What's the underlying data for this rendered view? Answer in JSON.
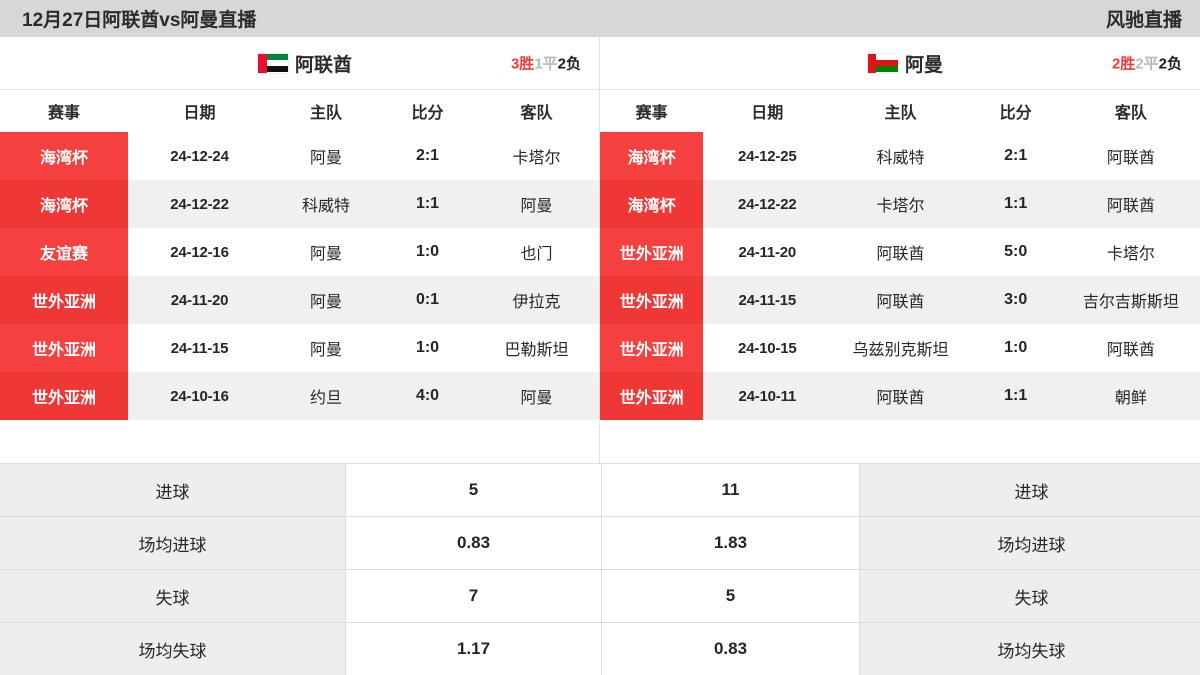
{
  "titlebar": {
    "match_title": "12月27日阿联酋vs阿曼直播",
    "site_brand": "风驰直播"
  },
  "colors": {
    "accent_red": "#f4403f",
    "win_red": "#ef3b3b",
    "draw_gray": "#b9b9b9",
    "loss_black": "#1c1c1c",
    "titlebar_bg": "#d7d7d7",
    "row_alt_bg": "#f0f0f0",
    "stats_label_bg": "#eeeeee"
  },
  "left_panel": {
    "team": {
      "name": "阿联酋",
      "flag_icon": "flag-uae-icon",
      "record": {
        "win": "3胜",
        "draw": "1平",
        "loss": "2负"
      }
    },
    "columns": [
      "赛事",
      "日期",
      "主队",
      "比分",
      "客队"
    ],
    "rows": [
      {
        "league": "海湾杯",
        "date": "24-12-24",
        "home": "阿曼",
        "score": "2:1",
        "away": "卡塔尔"
      },
      {
        "league": "海湾杯",
        "date": "24-12-22",
        "home": "科威特",
        "score": "1:1",
        "away": "阿曼"
      },
      {
        "league": "友谊赛",
        "date": "24-12-16",
        "home": "阿曼",
        "score": "1:0",
        "away": "也门"
      },
      {
        "league": "世外亚洲",
        "date": "24-11-20",
        "home": "阿曼",
        "score": "0:1",
        "away": "伊拉克"
      },
      {
        "league": "世外亚洲",
        "date": "24-11-15",
        "home": "阿曼",
        "score": "1:0",
        "away": "巴勒斯坦"
      },
      {
        "league": "世外亚洲",
        "date": "24-10-16",
        "home": "约旦",
        "score": "4:0",
        "away": "阿曼"
      }
    ]
  },
  "right_panel": {
    "team": {
      "name": "阿曼",
      "flag_icon": "flag-oman-icon",
      "record": {
        "win": "2胜",
        "draw": "2平",
        "loss": "2负"
      }
    },
    "columns": [
      "赛事",
      "日期",
      "主队",
      "比分",
      "客队"
    ],
    "rows": [
      {
        "league": "海湾杯",
        "date": "24-12-25",
        "home": "科威特",
        "score": "2:1",
        "away": "阿联酋"
      },
      {
        "league": "海湾杯",
        "date": "24-12-22",
        "home": "卡塔尔",
        "score": "1:1",
        "away": "阿联酋"
      },
      {
        "league": "世外亚洲",
        "date": "24-11-20",
        "home": "阿联酋",
        "score": "5:0",
        "away": "卡塔尔"
      },
      {
        "league": "世外亚洲",
        "date": "24-11-15",
        "home": "阿联酋",
        "score": "3:0",
        "away": "吉尔吉斯斯坦"
      },
      {
        "league": "世外亚洲",
        "date": "24-10-15",
        "home": "乌兹别克斯坦",
        "score": "1:0",
        "away": "阿联酋"
      },
      {
        "league": "世外亚洲",
        "date": "24-10-11",
        "home": "阿联酋",
        "score": "1:1",
        "away": "朝鲜"
      }
    ]
  },
  "stats": {
    "rows": [
      {
        "left_label": "进球",
        "left_value": "5",
        "right_value": "11",
        "right_label": "进球"
      },
      {
        "left_label": "场均进球",
        "left_value": "0.83",
        "right_value": "1.83",
        "right_label": "场均进球"
      },
      {
        "left_label": "失球",
        "left_value": "7",
        "right_value": "5",
        "right_label": "失球"
      },
      {
        "left_label": "场均失球",
        "left_value": "1.17",
        "right_value": "0.83",
        "right_label": "场均失球"
      }
    ]
  }
}
